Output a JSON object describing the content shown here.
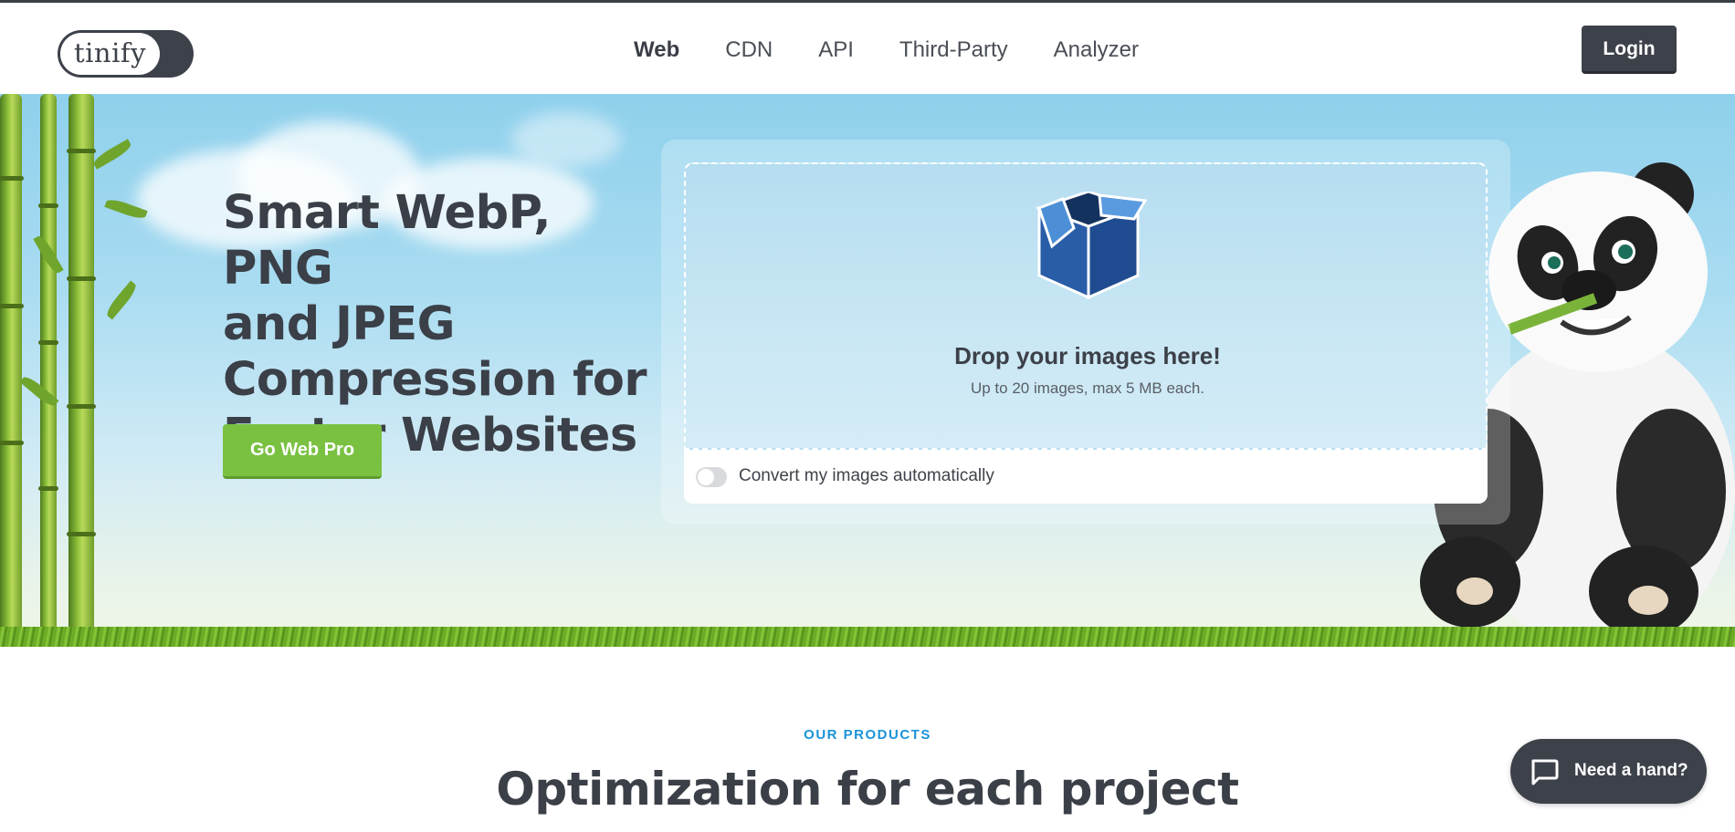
{
  "header": {
    "logo_text": "tinify",
    "nav": [
      "Web",
      "CDN",
      "API",
      "Third-Party",
      "Analyzer"
    ],
    "active_nav": "Web",
    "login_label": "Login"
  },
  "hero": {
    "title_lines": [
      "Smart WebP, PNG",
      "and JPEG",
      "Compression for",
      "Faster Websites"
    ],
    "cta_label": "Go Web Pro"
  },
  "dropzone": {
    "icon": "box-icon",
    "title": "Drop your images here!",
    "subtitle": "Up to 20 images, max 5 MB each.",
    "convert_label": "Convert my images automatically",
    "convert_enabled": false
  },
  "products": {
    "eyebrow": "OUR PRODUCTS",
    "title": "Optimization for each project"
  },
  "help": {
    "label": "Need a hand?",
    "icon": "chat-icon"
  },
  "colors": {
    "dark": "#3d414a",
    "green": "#7ac142",
    "blue_label": "#1a93d9"
  }
}
